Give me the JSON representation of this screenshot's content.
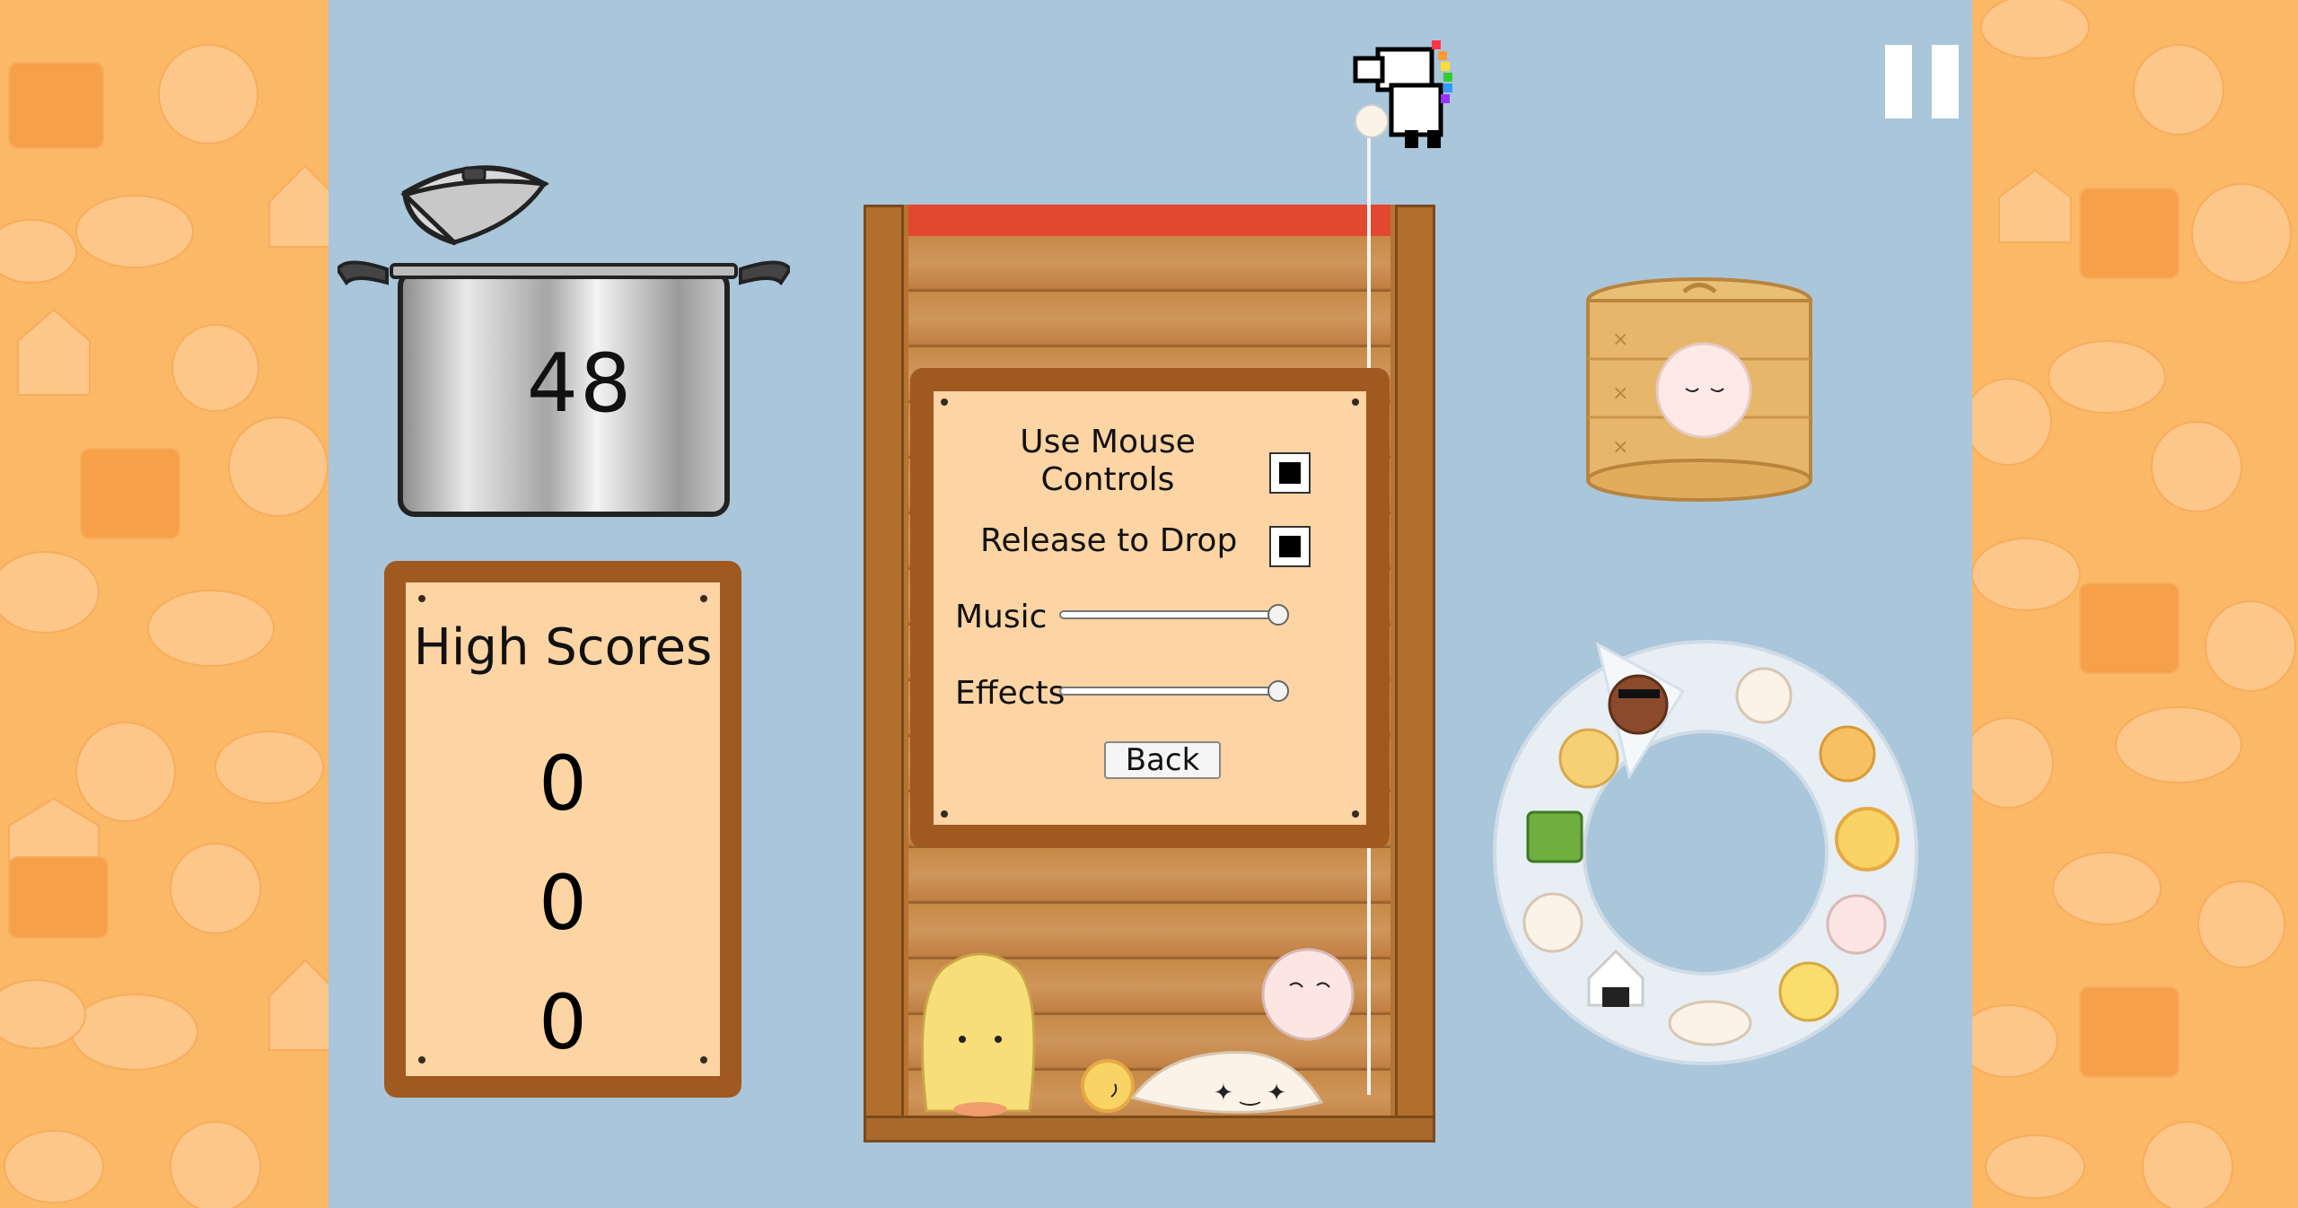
{
  "game": {
    "current_score": "48",
    "pause_icon": "pause-icon"
  },
  "high_scores": {
    "title": "High Scores",
    "scores": [
      "0",
      "0",
      "0"
    ]
  },
  "settings": {
    "use_mouse_line1": "Use Mouse",
    "use_mouse_line2": "Controls",
    "use_mouse_checked": true,
    "release_to_drop": "Release to Drop",
    "release_to_drop_checked": true,
    "music_label": "Music",
    "music_level": 1.0,
    "effects_label": "Effects",
    "effects_level": 1.0,
    "back_label": "Back"
  },
  "colors": {
    "background": "#a9c6db",
    "side_pattern": "#fbb866",
    "board_frame": "#a0591f",
    "board_inner": "#fdd4a3",
    "danger_line": "#e2472f"
  }
}
